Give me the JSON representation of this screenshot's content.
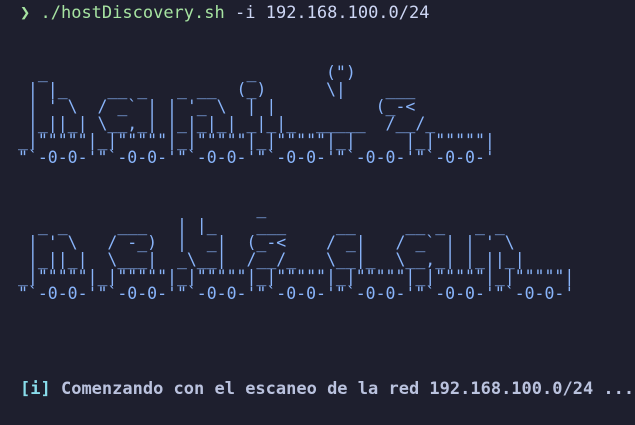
{
  "prompt": {
    "symbol": "❯",
    "command": "./hostDiscovery.sh",
    "flag": "-i",
    "argument": "192.168.100.0/24"
  },
  "banner": {
    "line1": "  _                    _       (\")       \n | |_    __ _   _ __  (_)      \\|    ___ \n | ' \\  / _` | | '_ \\  | |          (_-< \n |_||_| \\__,_| |_|_|_| _|_|_  _____  /__/_ \n_|\"\"\"\"\"|_|\"\"\"\"\"|_|\"\"\"\"\"|_|\"\"\"\"\"|_|     |_|\"\"\"\"\"|\n\"`-0-0-'\"`-0-0-'\"`-0-0-'\"`-0-0-'\"`-0-0-'\"`-0-0-'",
    "line2": "                        _                              \n  _ _     ___   | |_    ___     __     __ _   _ _   \n | ' \\   / -_)  |  _|  (_-<    / _|   / _` | | ' \\  \n |_||_|  \\___|  _\\__|  /__/_   \\__|_  \\__,_| |_||_| \n_|\"\"\"\"\"|_|\"\"\"\"\"|_|\"\"\"\"\"|_|\"\"\"\"\"|_|\"\"\"\"\"|_|\"\"\"\"\"|_|\"\"\"\"\"| \n\"`-0-0-'\"`-0-0-'\"`-0-0-'\"`-0-0-'\"`-0-0-'\"`-0-0-'\"`-0-0-'"
  },
  "status": {
    "tag": "[i]",
    "message": "Comenzando con el escaneo de la red 192.168.100.0/24 ..."
  },
  "colors": {
    "background": "#1e1f2e",
    "prompt_green": "#a6e3a1",
    "banner_blue": "#89b4fa",
    "status_cyan": "#89dceb"
  }
}
